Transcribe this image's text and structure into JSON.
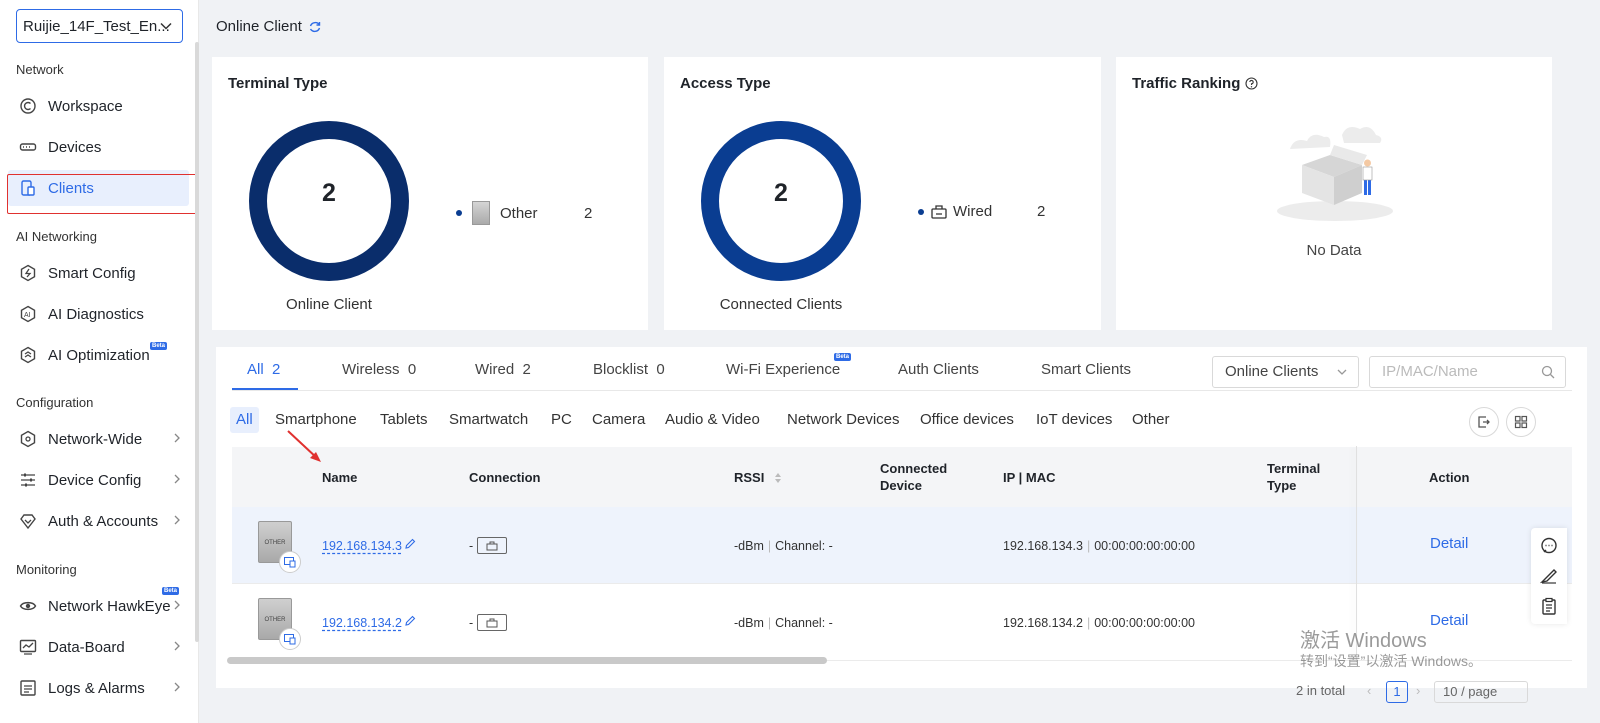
{
  "sidebar": {
    "site": "Ruijie_14F_Test_En...",
    "sections": {
      "network": "Network",
      "ai": "AI Networking",
      "config": "Configuration",
      "monitoring": "Monitoring"
    },
    "items": {
      "workspace": "Workspace",
      "devices": "Devices",
      "clients": "Clients",
      "smart_config": "Smart Config",
      "ai_diagnostics": "AI Diagnostics",
      "ai_optimization": "AI Optimization",
      "network_wide": "Network-Wide",
      "device_config": "Device Config",
      "auth_accounts": "Auth & Accounts",
      "network_hawkeye": "Network HawkEye",
      "data_board": "Data-Board",
      "logs_alarms": "Logs & Alarms"
    },
    "beta_label": "Beta"
  },
  "header": {
    "title": "Online Client"
  },
  "cards": {
    "terminal": {
      "title": "Terminal Type",
      "total": "2",
      "label": "Online Client",
      "legend_name": "Other",
      "legend_value": "2"
    },
    "access": {
      "title": "Access Type",
      "total": "2",
      "label": "Connected Clients",
      "legend_name": "Wired",
      "legend_value": "2"
    },
    "traffic": {
      "title": "Traffic Ranking",
      "empty": "No Data"
    }
  },
  "tabs": [
    {
      "label": "All",
      "count": "2"
    },
    {
      "label": "Wireless",
      "count": "0"
    },
    {
      "label": "Wired",
      "count": "2"
    },
    {
      "label": "Blocklist",
      "count": "0"
    },
    {
      "label": "Wi-Fi Experience",
      "count": ""
    },
    {
      "label": "Auth Clients",
      "count": ""
    },
    {
      "label": "Smart Clients",
      "count": ""
    }
  ],
  "filter": {
    "dropdown": "Online Clients",
    "search_placeholder": "IP/MAC/Name"
  },
  "chips": [
    "All",
    "Smartphone",
    "Tablets",
    "Smartwatch",
    "PC",
    "Camera",
    "Audio & Video",
    "Network Devices",
    "Office devices",
    "IoT devices",
    "Other"
  ],
  "table": {
    "headers": {
      "name": "Name",
      "connection": "Connection",
      "rssi": "RSSI",
      "connected_device": "Connected Device",
      "ip_mac": "IP | MAC",
      "terminal_type": "Terminal Type",
      "action": "Action"
    },
    "rows": [
      {
        "name": "192.168.134.3",
        "conn": "-",
        "rssi": "-dBm",
        "channel": "Channel: -",
        "ip": "192.168.134.3",
        "mac": "00:00:00:00:00:00",
        "action": "Detail",
        "img_text": "OTHER"
      },
      {
        "name": "192.168.134.2",
        "conn": "-",
        "rssi": "-dBm",
        "channel": "Channel: -",
        "ip": "192.168.134.2",
        "mac": "00:00:00:00:00:00",
        "action": "Detail",
        "img_text": "OTHER"
      }
    ]
  },
  "pager": {
    "total": "2 in total",
    "page": "1",
    "per_page": "10 / page"
  },
  "watermark": {
    "line1": "激活 Windows",
    "line2": "转到“设置”以激活 Windows。"
  },
  "colors": {
    "accent": "#2e6be6",
    "ring_dark": "#0a2d6b",
    "ring_blue": "#0a3d91",
    "highlight_box": "#e0312f"
  }
}
